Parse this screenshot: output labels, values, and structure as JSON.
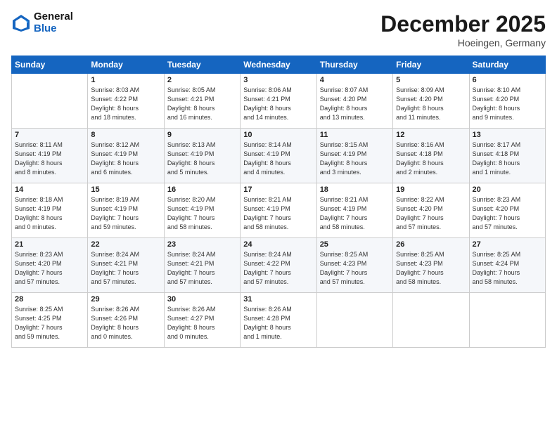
{
  "header": {
    "logo_line1": "General",
    "logo_line2": "Blue",
    "month": "December 2025",
    "location": "Hoeingen, Germany"
  },
  "weekdays": [
    "Sunday",
    "Monday",
    "Tuesday",
    "Wednesday",
    "Thursday",
    "Friday",
    "Saturday"
  ],
  "weeks": [
    [
      {
        "day": "",
        "info": ""
      },
      {
        "day": "1",
        "info": "Sunrise: 8:03 AM\nSunset: 4:22 PM\nDaylight: 8 hours\nand 18 minutes."
      },
      {
        "day": "2",
        "info": "Sunrise: 8:05 AM\nSunset: 4:21 PM\nDaylight: 8 hours\nand 16 minutes."
      },
      {
        "day": "3",
        "info": "Sunrise: 8:06 AM\nSunset: 4:21 PM\nDaylight: 8 hours\nand 14 minutes."
      },
      {
        "day": "4",
        "info": "Sunrise: 8:07 AM\nSunset: 4:20 PM\nDaylight: 8 hours\nand 13 minutes."
      },
      {
        "day": "5",
        "info": "Sunrise: 8:09 AM\nSunset: 4:20 PM\nDaylight: 8 hours\nand 11 minutes."
      },
      {
        "day": "6",
        "info": "Sunrise: 8:10 AM\nSunset: 4:20 PM\nDaylight: 8 hours\nand 9 minutes."
      }
    ],
    [
      {
        "day": "7",
        "info": "Sunrise: 8:11 AM\nSunset: 4:19 PM\nDaylight: 8 hours\nand 8 minutes."
      },
      {
        "day": "8",
        "info": "Sunrise: 8:12 AM\nSunset: 4:19 PM\nDaylight: 8 hours\nand 6 minutes."
      },
      {
        "day": "9",
        "info": "Sunrise: 8:13 AM\nSunset: 4:19 PM\nDaylight: 8 hours\nand 5 minutes."
      },
      {
        "day": "10",
        "info": "Sunrise: 8:14 AM\nSunset: 4:19 PM\nDaylight: 8 hours\nand 4 minutes."
      },
      {
        "day": "11",
        "info": "Sunrise: 8:15 AM\nSunset: 4:19 PM\nDaylight: 8 hours\nand 3 minutes."
      },
      {
        "day": "12",
        "info": "Sunrise: 8:16 AM\nSunset: 4:18 PM\nDaylight: 8 hours\nand 2 minutes."
      },
      {
        "day": "13",
        "info": "Sunrise: 8:17 AM\nSunset: 4:18 PM\nDaylight: 8 hours\nand 1 minute."
      }
    ],
    [
      {
        "day": "14",
        "info": "Sunrise: 8:18 AM\nSunset: 4:19 PM\nDaylight: 8 hours\nand 0 minutes."
      },
      {
        "day": "15",
        "info": "Sunrise: 8:19 AM\nSunset: 4:19 PM\nDaylight: 7 hours\nand 59 minutes."
      },
      {
        "day": "16",
        "info": "Sunrise: 8:20 AM\nSunset: 4:19 PM\nDaylight: 7 hours\nand 58 minutes."
      },
      {
        "day": "17",
        "info": "Sunrise: 8:21 AM\nSunset: 4:19 PM\nDaylight: 7 hours\nand 58 minutes."
      },
      {
        "day": "18",
        "info": "Sunrise: 8:21 AM\nSunset: 4:19 PM\nDaylight: 7 hours\nand 58 minutes."
      },
      {
        "day": "19",
        "info": "Sunrise: 8:22 AM\nSunset: 4:20 PM\nDaylight: 7 hours\nand 57 minutes."
      },
      {
        "day": "20",
        "info": "Sunrise: 8:23 AM\nSunset: 4:20 PM\nDaylight: 7 hours\nand 57 minutes."
      }
    ],
    [
      {
        "day": "21",
        "info": "Sunrise: 8:23 AM\nSunset: 4:20 PM\nDaylight: 7 hours\nand 57 minutes."
      },
      {
        "day": "22",
        "info": "Sunrise: 8:24 AM\nSunset: 4:21 PM\nDaylight: 7 hours\nand 57 minutes."
      },
      {
        "day": "23",
        "info": "Sunrise: 8:24 AM\nSunset: 4:21 PM\nDaylight: 7 hours\nand 57 minutes."
      },
      {
        "day": "24",
        "info": "Sunrise: 8:24 AM\nSunset: 4:22 PM\nDaylight: 7 hours\nand 57 minutes."
      },
      {
        "day": "25",
        "info": "Sunrise: 8:25 AM\nSunset: 4:23 PM\nDaylight: 7 hours\nand 57 minutes."
      },
      {
        "day": "26",
        "info": "Sunrise: 8:25 AM\nSunset: 4:23 PM\nDaylight: 7 hours\nand 58 minutes."
      },
      {
        "day": "27",
        "info": "Sunrise: 8:25 AM\nSunset: 4:24 PM\nDaylight: 7 hours\nand 58 minutes."
      }
    ],
    [
      {
        "day": "28",
        "info": "Sunrise: 8:25 AM\nSunset: 4:25 PM\nDaylight: 7 hours\nand 59 minutes."
      },
      {
        "day": "29",
        "info": "Sunrise: 8:26 AM\nSunset: 4:26 PM\nDaylight: 8 hours\nand 0 minutes."
      },
      {
        "day": "30",
        "info": "Sunrise: 8:26 AM\nSunset: 4:27 PM\nDaylight: 8 hours\nand 0 minutes."
      },
      {
        "day": "31",
        "info": "Sunrise: 8:26 AM\nSunset: 4:28 PM\nDaylight: 8 hours\nand 1 minute."
      },
      {
        "day": "",
        "info": ""
      },
      {
        "day": "",
        "info": ""
      },
      {
        "day": "",
        "info": ""
      }
    ]
  ]
}
